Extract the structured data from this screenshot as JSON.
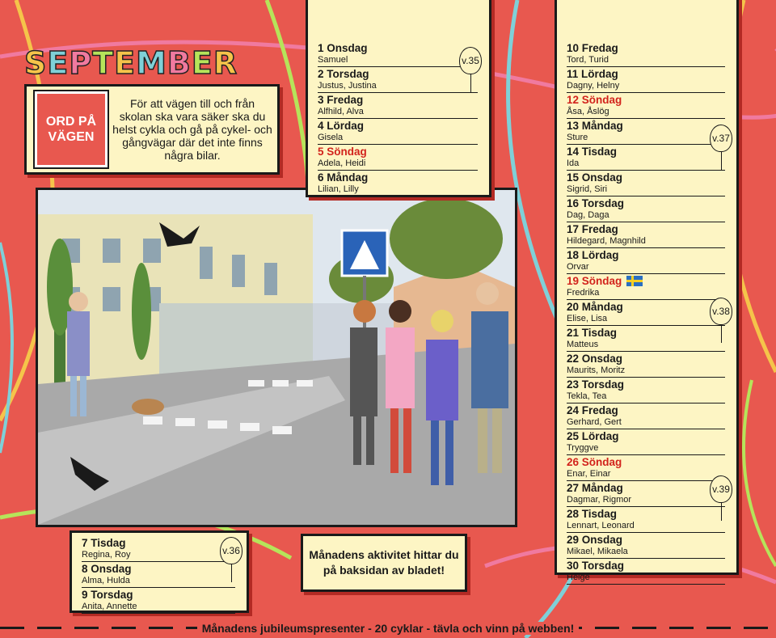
{
  "title": {
    "text": "SEPTEMBER",
    "letter_colors": [
      "#f5c44a",
      "#7fd0d8",
      "#f07aa0",
      "#b6e45a",
      "#f5c44a",
      "#7fd0d8",
      "#f07aa0",
      "#b6e45a",
      "#f5c44a"
    ]
  },
  "info": {
    "badge": "ORD PÅ VÄGEN",
    "text": "För att vägen till och från skolan ska vara säker ska du helst cykla och gå på cykel- och gångvägar där det inte finns några bilar."
  },
  "weeks": {
    "w35": "v.35",
    "w36": "v.36",
    "w37": "v.37",
    "w38": "v.38",
    "w39": "v.39"
  },
  "days_col1": [
    {
      "head": "1 Onsdag",
      "names": "Samuel",
      "sunday": false
    },
    {
      "head": "2 Torsdag",
      "names": "Justus, Justina",
      "sunday": false
    },
    {
      "head": "3 Fredag",
      "names": "Alfhild, Alva",
      "sunday": false
    },
    {
      "head": "4 Lördag",
      "names": "Gisela",
      "sunday": false
    },
    {
      "head": "5 Söndag",
      "names": "Adela, Heidi",
      "sunday": true
    },
    {
      "head": "6 Måndag",
      "names": "Lilian, Lilly",
      "sunday": false
    }
  ],
  "days_col3": [
    {
      "head": "7 Tisdag",
      "names": "Regina, Roy",
      "sunday": false
    },
    {
      "head": "8 Onsdag",
      "names": "Alma, Hulda",
      "sunday": false
    },
    {
      "head": "9 Torsdag",
      "names": "Anita, Annette",
      "sunday": false
    }
  ],
  "days_col2": [
    {
      "head": "10 Fredag",
      "names": "Tord, Turid",
      "sunday": false
    },
    {
      "head": "11 Lördag",
      "names": "Dagny, Helny",
      "sunday": false
    },
    {
      "head": "12 Söndag",
      "names": "Åsa, Åslög",
      "sunday": true
    },
    {
      "head": "13 Måndag",
      "names": "Sture",
      "sunday": false
    },
    {
      "head": "14 Tisdag",
      "names": "Ida",
      "sunday": false
    },
    {
      "head": "15 Onsdag",
      "names": "Sigrid, Siri",
      "sunday": false
    },
    {
      "head": "16 Torsdag",
      "names": "Dag, Daga",
      "sunday": false
    },
    {
      "head": "17 Fredag",
      "names": "Hildegard, Magnhild",
      "sunday": false
    },
    {
      "head": "18 Lördag",
      "names": "Orvar",
      "sunday": false
    },
    {
      "head": "19 Söndag",
      "names": "Fredrika",
      "sunday": true,
      "flag": "swedish-flag-icon"
    },
    {
      "head": "20 Måndag",
      "names": "Elise, Lisa",
      "sunday": false
    },
    {
      "head": "21 Tisdag",
      "names": "Matteus",
      "sunday": false
    },
    {
      "head": "22 Onsdag",
      "names": "Maurits, Moritz",
      "sunday": false
    },
    {
      "head": "23 Torsdag",
      "names": "Tekla, Tea",
      "sunday": false
    },
    {
      "head": "24 Fredag",
      "names": "Gerhard, Gert",
      "sunday": false
    },
    {
      "head": "25 Lördag",
      "names": "Tryggve",
      "sunday": false
    },
    {
      "head": "26 Söndag",
      "names": "Enar, Einar",
      "sunday": true
    },
    {
      "head": "27 Måndag",
      "names": "Dagmar, Rigmor",
      "sunday": false
    },
    {
      "head": "28 Tisdag",
      "names": "Lennart, Leonard",
      "sunday": false
    },
    {
      "head": "29 Onsdag",
      "names": "Mikael, Mikaela",
      "sunday": false
    },
    {
      "head": "30 Torsdag",
      "names": "Helge",
      "sunday": false
    }
  ],
  "activity": "Månadens aktivitet hittar du på baksidan av bladet!",
  "footer": "Månadens jubileumspresenter - 20 cyklar - tävla och vinn på webben!",
  "colors": {
    "background": "#e8584f",
    "paper": "#fdf5c4",
    "sunday": "#d2231c"
  }
}
